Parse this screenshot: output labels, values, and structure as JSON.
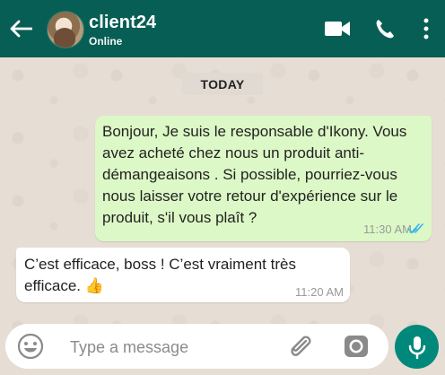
{
  "header": {
    "contact_name": "client24",
    "status": "Online",
    "icons": [
      "back-arrow-icon",
      "video-call-icon",
      "phone-icon",
      "more-options-icon"
    ],
    "background_color": "#075e54"
  },
  "chat": {
    "date_label": "TODAY",
    "messages": [
      {
        "direction": "outgoing",
        "text": "Bonjour, Je suis le responsable d'Ikony. Vous avez acheté chez nous un produit anti-démangeaisons . Si possible, pourriez-vous nous laisser votre retour d'expérience sur le produit, s'il vous plaît ?",
        "time": "11:30 AM",
        "status_icon": "double-check-icon",
        "bubble_color": "#dcf8c6"
      },
      {
        "direction": "incoming",
        "text": "C’est efficace, boss ! C’est vraiment très efficace. 👍",
        "time": "11:20 AM",
        "bubble_color": "#ffffff"
      }
    ]
  },
  "composer": {
    "placeholder": "Type a message",
    "value": "",
    "icons": [
      "emoji-icon",
      "paperclip-icon",
      "camera-icon",
      "microphone-icon"
    ],
    "mic_button_color": "#00897b"
  }
}
